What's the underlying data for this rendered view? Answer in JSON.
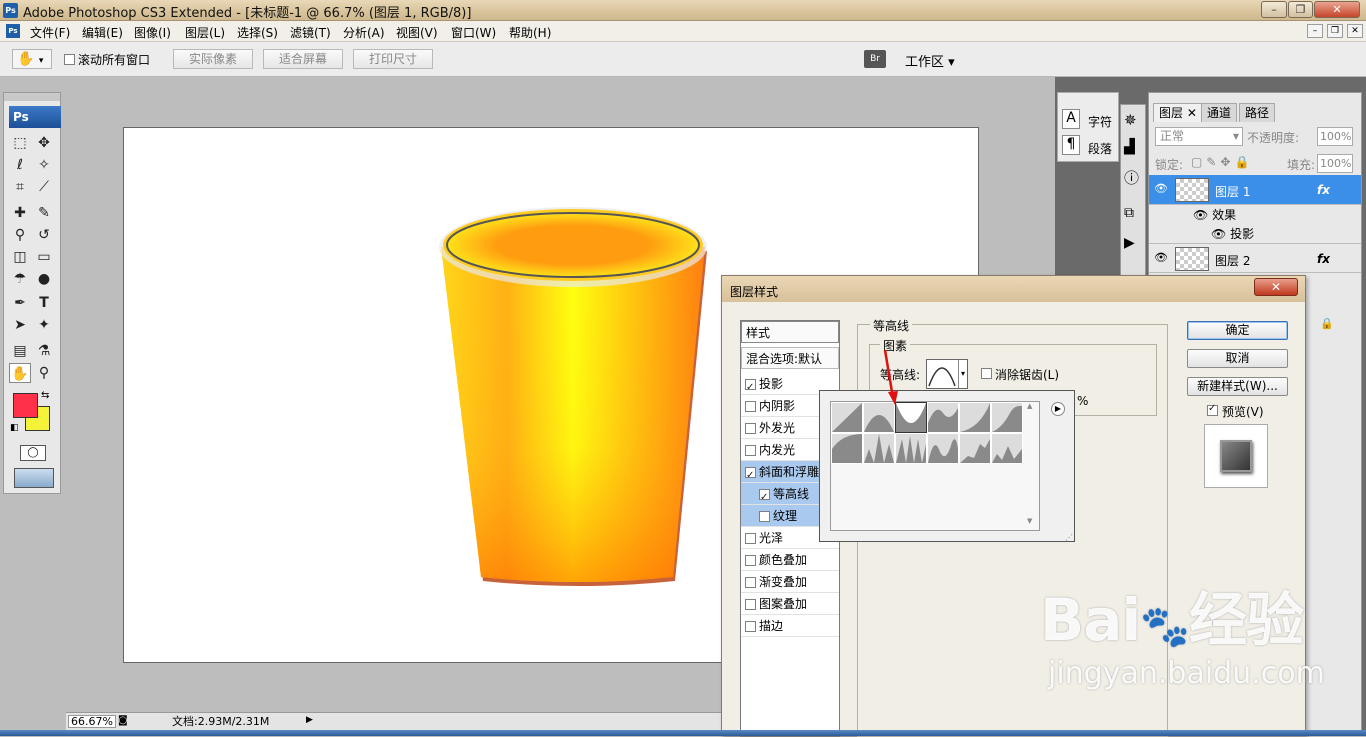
{
  "app": {
    "title": "Adobe Photoshop CS3 Extended - [未标题-1 @ 66.7% (图层 1, RGB/8)]",
    "logo": "Ps"
  },
  "window_controls": {
    "minimize": "–",
    "restore": "❐",
    "close": "✕"
  },
  "menu": [
    "文件(F)",
    "编辑(E)",
    "图像(I)",
    "图层(L)",
    "选择(S)",
    "滤镜(T)",
    "分析(A)",
    "视图(V)",
    "窗口(W)",
    "帮助(H)"
  ],
  "options": {
    "scroll_all_label": "滚动所有窗口",
    "actual_pixels": "实际像素",
    "fit_screen": "适合屏幕",
    "print_size": "打印尺寸",
    "workspace": "工作区 ▾",
    "hand_icon": "hand-icon"
  },
  "toolbox": {
    "logo": "Ps"
  },
  "status": {
    "zoom": "66.67%",
    "doc": "文档:2.93M/2.31M"
  },
  "char_panel": {
    "char": "字符",
    "para": "段落"
  },
  "layers_panel": {
    "tabs": [
      "图层",
      "通道",
      "路径"
    ],
    "blend_mode": "正常",
    "opacity_label": "不透明度:",
    "opacity_value": "100%",
    "lock_label": "锁定:",
    "fill_label": "填充:",
    "fill_value": "100%",
    "layer1": "图层 1",
    "effects": "效果",
    "dropshadow": "投影",
    "layer2": "图层 2",
    "fx": "fx"
  },
  "dialog": {
    "title": "图层样式",
    "close": "✕",
    "styles_header": "样式",
    "blend_default": "混合选项:默认",
    "items": [
      {
        "label": "投影",
        "checked": true
      },
      {
        "label": "内阴影",
        "checked": false
      },
      {
        "label": "外发光",
        "checked": false
      },
      {
        "label": "内发光",
        "checked": false
      },
      {
        "label": "斜面和浮雕",
        "checked": true
      },
      {
        "label": "等高线",
        "checked": true
      },
      {
        "label": "纹理",
        "checked": false
      },
      {
        "label": "光泽",
        "checked": false
      },
      {
        "label": "颜色叠加",
        "checked": false
      },
      {
        "label": "渐变叠加",
        "checked": false
      },
      {
        "label": "图案叠加",
        "checked": false
      },
      {
        "label": "描边",
        "checked": false
      }
    ],
    "section_title": "等高线",
    "group_title": "图素",
    "contour_label": "等高线:",
    "antialias_label": "消除锯齿(L)",
    "range_unit": "%",
    "ok": "确定",
    "cancel": "取消",
    "new_style": "新建样式(W)...",
    "preview": "预览(V)"
  },
  "watermark": {
    "brand": "Bai",
    "brand_cn": "经验",
    "url": "jingyan.baidu.com"
  },
  "colors": {
    "foreground": "#ff3047",
    "background": "#f5f23a",
    "accent": "#3c8fe8"
  }
}
